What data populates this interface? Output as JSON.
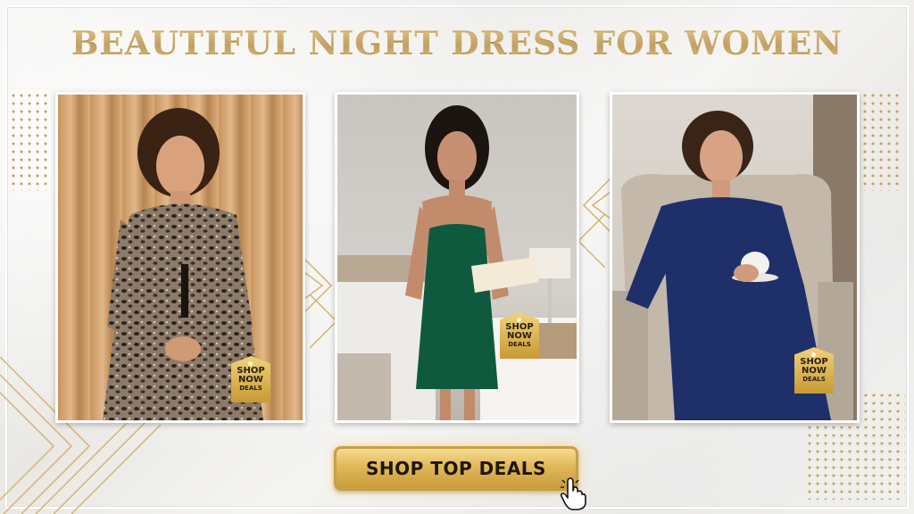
{
  "banner": {
    "title": "BEAUTIFUL NIGHT DRESS FOR WOMEN",
    "cta_label": "SHOP TOP DEALS",
    "colors": {
      "gold": "#c9a04a",
      "gold_dark": "#a8761f",
      "background": "#f2f1ef"
    },
    "products": [
      {
        "image_alt": "Woman with curly hair in a leopard print long-sleeve night dress standing before beige curtains",
        "dress_color": "#6b5a4a",
        "tag": {
          "line1": "SHOP",
          "line2": "NOW",
          "line3": "DEALS"
        }
      },
      {
        "image_alt": "Woman in an emerald green satin slip night dress holding an open book in a bedroom",
        "dress_color": "#0f5a3e",
        "tag": {
          "line1": "SHOP",
          "line2": "NOW",
          "line3": "DEALS"
        }
      },
      {
        "image_alt": "Woman in a navy blue loose night dress seated in an armchair holding a cup of tea",
        "dress_color": "#1e2f6a",
        "tag": {
          "line1": "SHOP",
          "line2": "NOW",
          "line3": "DEALS"
        }
      }
    ],
    "icons": [
      "price-tag-icon",
      "hand-pointer-icon"
    ]
  }
}
